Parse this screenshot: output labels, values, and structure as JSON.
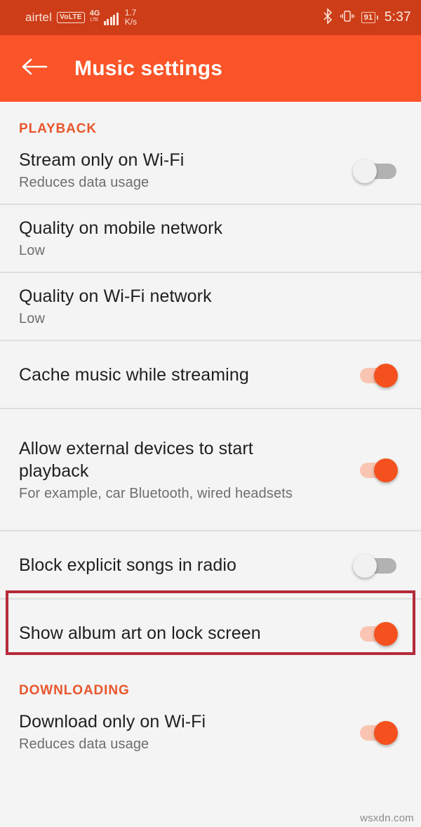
{
  "status_bar": {
    "carrier": "airtel",
    "volte_badge": "VoLTE",
    "network_generation": "4G",
    "network_generation_sup": "+",
    "network_sub": "LTE",
    "data_rate_value": "1.7",
    "data_rate_unit": "K/s",
    "bluetooth_icon": "bluetooth-icon",
    "vibrate_icon": "vibrate-icon",
    "battery_level": "91",
    "time": "5:37"
  },
  "app_bar": {
    "back_icon": "back-arrow-icon",
    "title": "Music settings"
  },
  "sections": [
    {
      "header": "PLAYBACK",
      "rows": [
        {
          "title": "Stream only on Wi-Fi",
          "subtitle": "Reduces data usage",
          "control": "toggle",
          "state": "off"
        },
        {
          "title": "Quality on mobile network",
          "subtitle": "Low",
          "control": "none",
          "state": ""
        },
        {
          "title": "Quality on Wi-Fi network",
          "subtitle": "Low",
          "control": "none",
          "state": ""
        },
        {
          "title": "Cache music while streaming",
          "subtitle": "",
          "control": "toggle",
          "state": "on"
        },
        {
          "title": "Allow external devices to start playback",
          "subtitle": "For example, car Bluetooth, wired headsets",
          "control": "toggle",
          "state": "on"
        },
        {
          "title": "Block explicit songs in radio",
          "subtitle": "",
          "control": "toggle",
          "state": "off"
        },
        {
          "title": "Show album art on lock screen",
          "subtitle": "",
          "control": "toggle",
          "state": "on"
        }
      ]
    },
    {
      "header": "DOWNLOADING",
      "rows": [
        {
          "title": "Download only on Wi-Fi",
          "subtitle": "Reduces data usage",
          "control": "toggle",
          "state": "on"
        }
      ]
    }
  ],
  "annotation": {
    "name": "highlight-box",
    "target": "Block explicit songs in radio",
    "color": "#b52a3a"
  },
  "watermark": "wsxdn.com",
  "colors": {
    "status_bar": "#cc3d18",
    "app_bar": "#fa5428",
    "section_header": "#e8562c",
    "toggle_on": "#f4511e",
    "toggle_on_track": "#f9c5b2",
    "toggle_off_track": "#b2b2b2",
    "background": "#f4f4f4"
  }
}
